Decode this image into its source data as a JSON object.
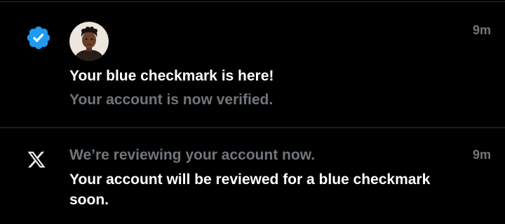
{
  "notifications": [
    {
      "type_icon": "verified-badge-icon",
      "avatar": "user-avatar",
      "time": "9m",
      "title": "Your blue checkmark is here!",
      "subtitle": "Your account is now verified."
    },
    {
      "type_icon": "x-logo-icon",
      "time": "9m",
      "title": "We’re reviewing your account now.",
      "body": "Your account will be reviewed for a blue checkmark soon."
    }
  ],
  "colors": {
    "background": "#000000",
    "divider": "#2f3336",
    "primary_text": "#ffffff",
    "muted_text": "#71767b",
    "verified_blue": "#1d9bf0"
  }
}
